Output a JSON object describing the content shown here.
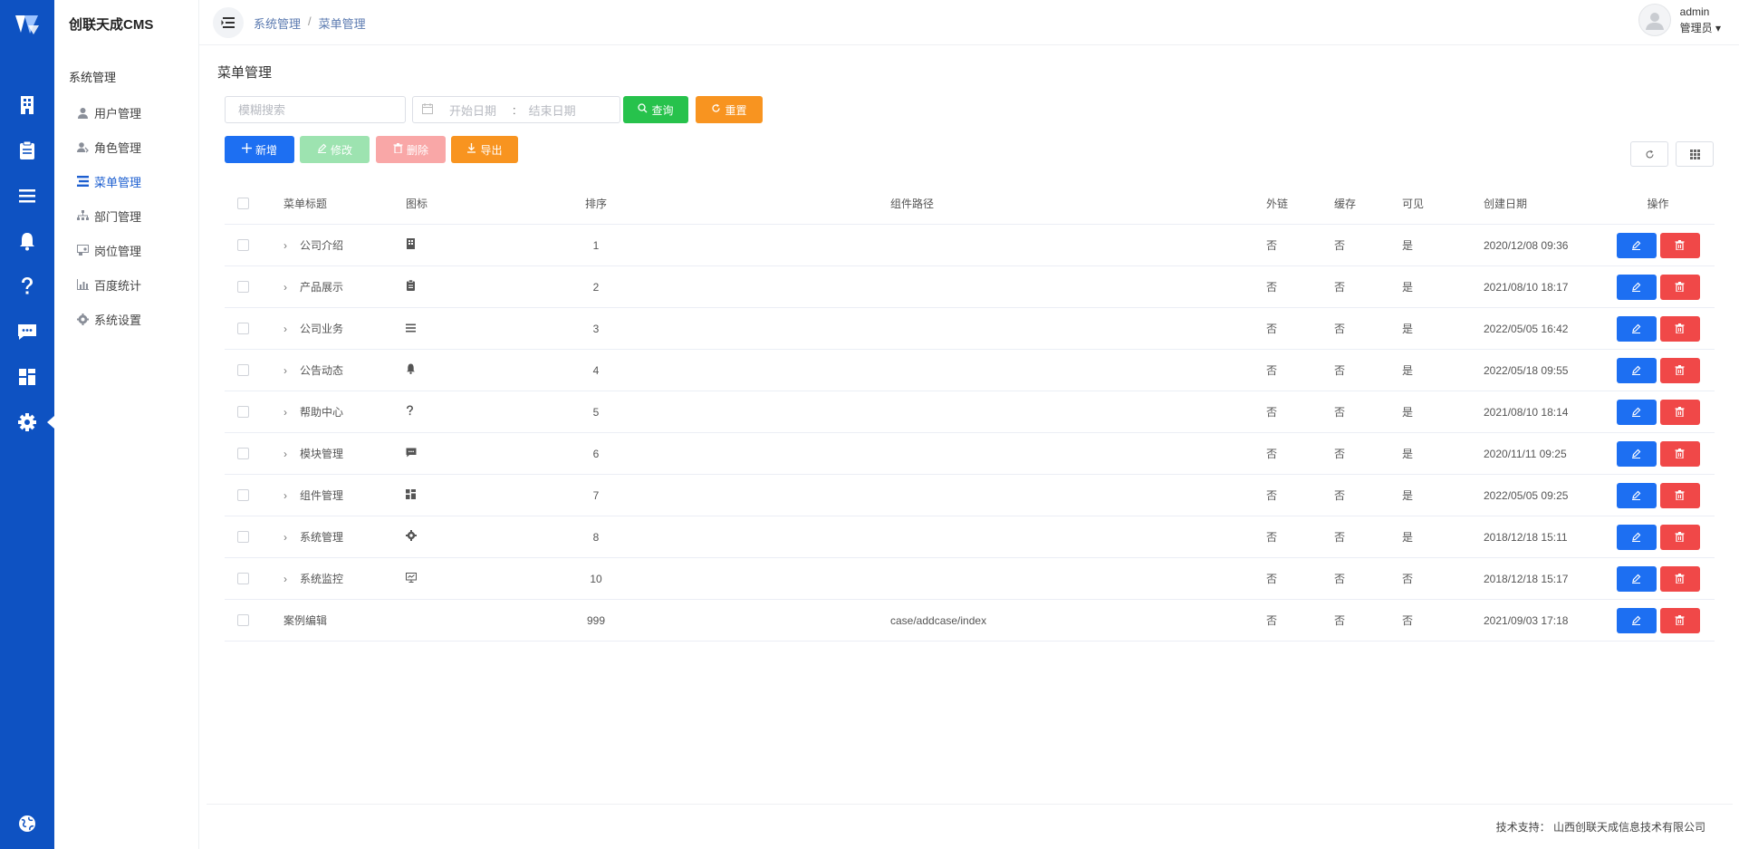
{
  "brand": "创联天成CMS",
  "sidebar": {
    "group": "系统管理",
    "items": [
      {
        "label": "用户管理",
        "icon": "user-icon"
      },
      {
        "label": "角色管理",
        "icon": "role-icon"
      },
      {
        "label": "菜单管理",
        "icon": "menu-icon",
        "active": true
      },
      {
        "label": "部门管理",
        "icon": "tree-icon"
      },
      {
        "label": "岗位管理",
        "icon": "post-icon"
      },
      {
        "label": "百度统计",
        "icon": "chart-icon"
      },
      {
        "label": "系统设置",
        "icon": "gear-icon"
      }
    ]
  },
  "rail": [
    "building-icon",
    "clipboard-icon",
    "list-icon",
    "bell-icon",
    "question-icon",
    "chat-icon",
    "apps-icon",
    "gear-icon",
    "globe-icon"
  ],
  "header": {
    "breadcrumb": [
      "系统管理",
      "菜单管理"
    ],
    "username": "admin",
    "role": "管理员 ▾"
  },
  "page": {
    "title": "菜单管理",
    "search_placeholder": "模糊搜索",
    "date_start": "开始日期",
    "date_sep": ":",
    "date_end": "结束日期",
    "btn_query": "查询",
    "btn_reset": "重置",
    "btn_add": "新增",
    "btn_edit": "修改",
    "btn_delete": "删除",
    "btn_export": "导出"
  },
  "table": {
    "columns": [
      "菜单标题",
      "图标",
      "排序",
      "组件路径",
      "外链",
      "缓存",
      "可见",
      "创建日期",
      "操作"
    ],
    "rows": [
      {
        "title": "公司介绍",
        "icon": "building-icon",
        "sort": "1",
        "path": "",
        "ext": "否",
        "cache": "否",
        "visible": "是",
        "date": "2020/12/08 09:36",
        "expand": true
      },
      {
        "title": "产品展示",
        "icon": "clipboard-icon",
        "sort": "2",
        "path": "",
        "ext": "否",
        "cache": "否",
        "visible": "是",
        "date": "2021/08/10 18:17",
        "expand": true
      },
      {
        "title": "公司业务",
        "icon": "list-icon",
        "sort": "3",
        "path": "",
        "ext": "否",
        "cache": "否",
        "visible": "是",
        "date": "2022/05/05 16:42",
        "expand": true
      },
      {
        "title": "公告动态",
        "icon": "bell-icon",
        "sort": "4",
        "path": "",
        "ext": "否",
        "cache": "否",
        "visible": "是",
        "date": "2022/05/18 09:55",
        "expand": true
      },
      {
        "title": "帮助中心",
        "icon": "question-icon",
        "sort": "5",
        "path": "",
        "ext": "否",
        "cache": "否",
        "visible": "是",
        "date": "2021/08/10 18:14",
        "expand": true
      },
      {
        "title": "模块管理",
        "icon": "chat-icon",
        "sort": "6",
        "path": "",
        "ext": "否",
        "cache": "否",
        "visible": "是",
        "date": "2020/11/11 09:25",
        "expand": true
      },
      {
        "title": "组件管理",
        "icon": "apps-icon",
        "sort": "7",
        "path": "",
        "ext": "否",
        "cache": "否",
        "visible": "是",
        "date": "2022/05/05 09:25",
        "expand": true
      },
      {
        "title": "系统管理",
        "icon": "gear-icon",
        "sort": "8",
        "path": "",
        "ext": "否",
        "cache": "否",
        "visible": "是",
        "date": "2018/12/18 15:11",
        "expand": true
      },
      {
        "title": "系统监控",
        "icon": "monitor-icon",
        "sort": "10",
        "path": "",
        "ext": "否",
        "cache": "否",
        "visible": "否",
        "date": "2018/12/18 15:17",
        "expand": true
      },
      {
        "title": "案例编辑",
        "icon": "",
        "sort": "999",
        "path": "case/addcase/index",
        "ext": "否",
        "cache": "否",
        "visible": "否",
        "date": "2021/09/03 17:18",
        "expand": false
      }
    ]
  },
  "footer": {
    "label": "技术支持：",
    "company": "山西创联天成信息技术有限公司"
  },
  "colors": {
    "rail": "#0e52c2",
    "primary": "#1d6ff2",
    "success": "#27c24c",
    "warning": "#f89420",
    "danger": "#f04848"
  }
}
